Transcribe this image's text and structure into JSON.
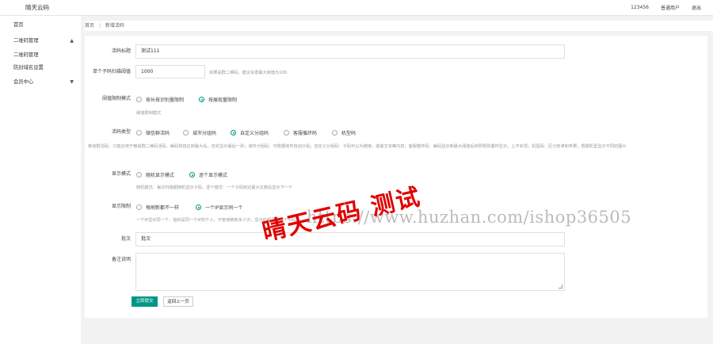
{
  "header": {
    "brand": "晴天云码",
    "user_id": "123456",
    "user_role": "普通用户",
    "logout": "退出"
  },
  "sidebar": {
    "items": [
      {
        "label": "首页"
      },
      {
        "label": "二维码管理"
      },
      {
        "label": "二维码管理"
      },
      {
        "label": "防封域名设置"
      },
      {
        "label": "会员中心"
      }
    ]
  },
  "breadcrumb": {
    "home": "首页",
    "sep": "/",
    "current": "新增活码"
  },
  "form": {
    "title_label": "活码标题",
    "title_value": "测试111",
    "threshold_label": "单个子码扫描阈值",
    "threshold_value": "1000",
    "threshold_help": "如果是群二维码，建议设置最大阈值为100",
    "limit_mode_label": "阈值限制模式",
    "limit_mode_opt1": "按长按识别量限制",
    "limit_mode_opt2": "按展现量限制",
    "limit_mode_help": "阈值限制模式",
    "type_label": "活码类型",
    "type_opts": [
      "微信群活码",
      "城市分组码",
      "自定义分组码",
      "客服循环码",
      "机型码"
    ],
    "type_help": "微信群活码：只能应用于微信群二维码活码，每码将自达到最大后，自定显示最后一张；城市分组码：可根据城市自动分组；自定义分组码：子码可以为链接，或者文本等内容；客服循环码：每码显示到最大阈值后依照规则循环显示，上不封顶；机型码：区分安卓和苹果，根据机型显示不同的图片",
    "display_mode_label": "显示模式",
    "display_mode_opt1": "随机显示模式",
    "display_mode_opt2": "逐个显示模式",
    "display_mode_help": "随机模式：每次扫描都随机显示子码，逐个模式：一个子码到达最大次数后显示下一个",
    "display_limit_label": "显示限制",
    "display_limit_opt1": "每刷新都不一样",
    "display_limit_opt2": "一个IP显示同一个",
    "display_limit_help": "一个IP显示同一个：指的是同一个IP的个人，不管他刷新多少次，显示的都是同一个子码",
    "batch_label": "批次",
    "batch_value": "批次",
    "remark_label": "备注说明",
    "submit": "立即提交",
    "back": "返回上一页"
  },
  "watermark": {
    "url": "https://www.huzhan.com/ishop36505",
    "red_text": "晴天云码 测试"
  },
  "colors": {
    "accent": "#009688",
    "watermark_red": "#e00000"
  }
}
